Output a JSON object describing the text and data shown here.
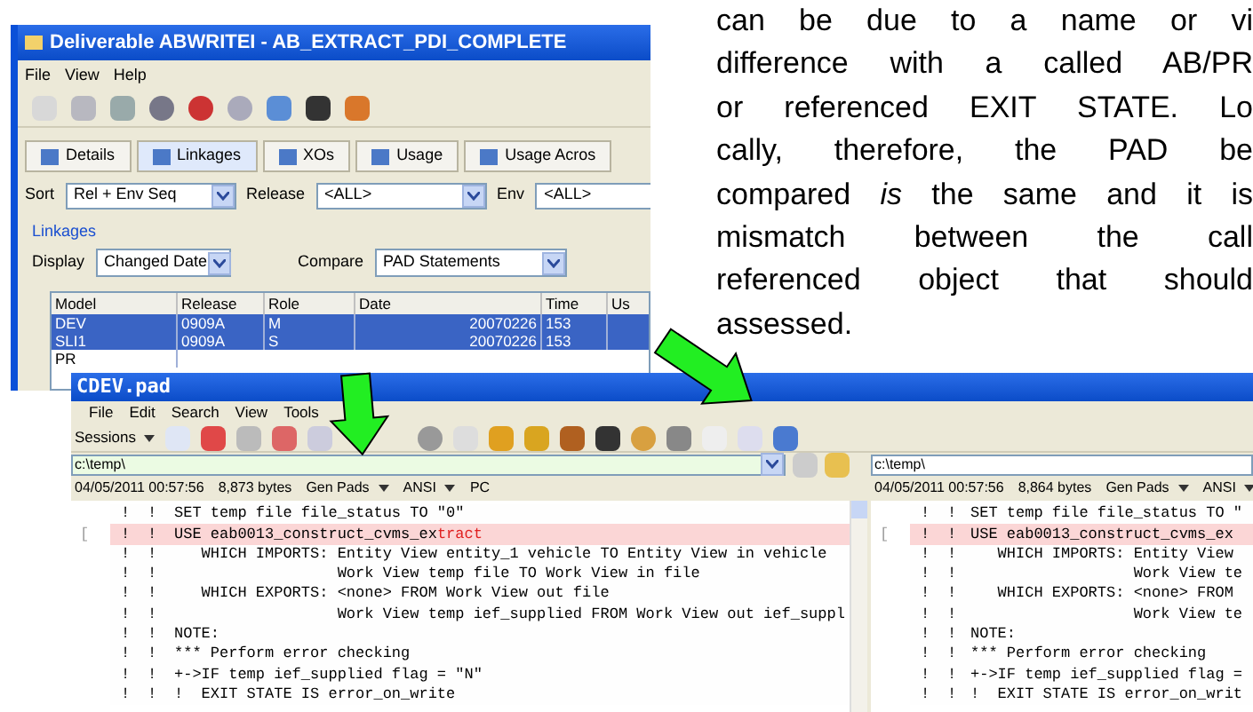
{
  "top_window": {
    "title": "Deliverable ABWRITEI - AB_EXTRACT_PDI_COMPLETE",
    "menu": [
      "File",
      "View",
      "Help"
    ],
    "tabs": [
      {
        "label": "Details",
        "selected": false
      },
      {
        "label": "Linkages",
        "selected": true
      },
      {
        "label": "XOs",
        "selected": false
      },
      {
        "label": "Usage",
        "selected": false
      },
      {
        "label": "Usage Acros",
        "selected": false
      }
    ],
    "filters": [
      {
        "label": "Sort",
        "value": "Rel + Env Seq"
      },
      {
        "label": "Release",
        "value": "<ALL>"
      },
      {
        "label": "Env",
        "value": "<ALL>"
      }
    ],
    "linkages": {
      "legend": "Linkages",
      "display": {
        "label": "Display",
        "value": "Changed Date"
      },
      "compare": {
        "label": "Compare",
        "value": "PAD Statements"
      }
    },
    "table": {
      "columns": [
        "Model",
        "Release",
        "Role",
        "Date",
        "Time",
        "Us"
      ],
      "rows": [
        {
          "cells": [
            "DEV",
            "0909A",
            "M",
            "20070226",
            "153"
          ],
          "selected": true
        },
        {
          "cells": [
            "SLI1",
            "0909A",
            "S",
            "20070226",
            "153"
          ],
          "selected": true
        },
        {
          "cells": [
            "PR"
          ],
          "selected": false
        }
      ]
    }
  },
  "paragraph": {
    "lines": [
      "can be due to a name or vi",
      "difference with a called AB/PR",
      "or referenced EXIT STATE. Lo",
      "cally, therefore, the PAD be",
      "compared *is* the same and it is",
      "mismatch between the call",
      "referenced object that should",
      "assessed."
    ]
  },
  "compare_window": {
    "title": "CDEV.pad",
    "menu": [
      "File",
      "Edit",
      "Search",
      "View",
      "Tools"
    ],
    "sessions": "Sessions",
    "panes": [
      {
        "path": "c:\\temp\\",
        "timestamp": "04/05/2011 00:57:56",
        "size": "8,873 bytes",
        "format": "Gen Pads",
        "encoding": "ANSI",
        "line_ending": "PC",
        "lines": [
          {
            "markers": [
              "!",
              "!"
            ],
            "text": "SET temp file file_status TO \"0\"",
            "changed": false
          },
          {
            "markers": [
              "!",
              "!"
            ],
            "text": "USE eab0013_construct_cvms_ex",
            "changed_tail": "tract",
            "gutter_mark": "[",
            "changed": true
          },
          {
            "markers": [
              "!",
              "!"
            ],
            "text": "   WHICH IMPORTS: Entity View entity_1 vehicle TO Entity View in vehicle",
            "changed": false
          },
          {
            "markers": [
              "!",
              "!"
            ],
            "text": "                  Work View temp file TO Work View in file",
            "changed": false
          },
          {
            "markers": [
              "!",
              "!"
            ],
            "text": "   WHICH EXPORTS: <none> FROM Work View out file",
            "changed": false
          },
          {
            "markers": [
              "!",
              "!"
            ],
            "text": "                  Work View temp ief_supplied FROM Work View out ief_suppl",
            "changed": false
          },
          {
            "markers": [
              "!",
              "!"
            ],
            "text": "NOTE:",
            "changed": false
          },
          {
            "markers": [
              "!",
              "!"
            ],
            "text": "*** Perform error checking",
            "changed": false
          },
          {
            "markers": [
              "!",
              "!"
            ],
            "text": "+->IF temp ief_supplied flag = \"N\"",
            "changed": false
          },
          {
            "markers": [
              "!",
              "!"
            ],
            "text": "!  EXIT STATE IS error_on_write",
            "changed": false
          }
        ]
      },
      {
        "path": "c:\\temp\\",
        "timestamp": "04/05/2011 00:57:56",
        "size": "8,864 bytes",
        "format": "Gen Pads",
        "encoding": "ANSI",
        "lines": [
          {
            "markers": [
              "!",
              "!"
            ],
            "text": "SET temp file file_status TO \"",
            "changed": false
          },
          {
            "markers": [
              "!",
              "!"
            ],
            "text": "USE eab0013_construct_cvms_ex",
            "gutter_mark": "[",
            "changed": true
          },
          {
            "markers": [
              "!",
              "!"
            ],
            "text": "   WHICH IMPORTS: Entity View",
            "changed": false
          },
          {
            "markers": [
              "!",
              "!"
            ],
            "text": "                  Work View te",
            "changed": false
          },
          {
            "markers": [
              "!",
              "!"
            ],
            "text": "   WHICH EXPORTS: <none> FROM",
            "changed": false
          },
          {
            "markers": [
              "!",
              "!"
            ],
            "text": "                  Work View te",
            "changed": false
          },
          {
            "markers": [
              "!",
              "!"
            ],
            "text": "NOTE:",
            "changed": false
          },
          {
            "markers": [
              "!",
              "!"
            ],
            "text": "*** Perform error checking",
            "changed": false
          },
          {
            "markers": [
              "!",
              "!"
            ],
            "text": "+->IF temp ief_supplied flag =",
            "changed": false
          },
          {
            "markers": [
              "!",
              "!"
            ],
            "text": "!  EXIT STATE IS error_on_writ",
            "changed": false
          }
        ]
      }
    ]
  }
}
